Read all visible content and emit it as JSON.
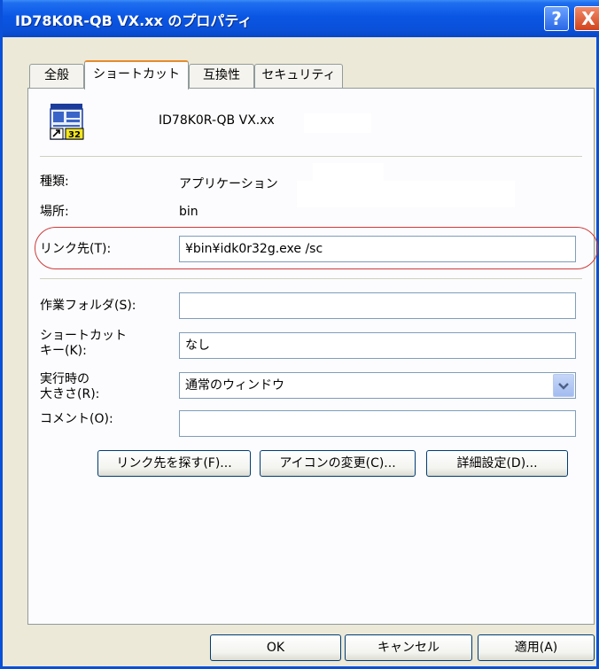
{
  "window": {
    "title": "ID78K0R-QB VX.xx のプロパティ"
  },
  "titlebar_buttons": {
    "help": "?",
    "close": "X"
  },
  "tabs": [
    {
      "label": "全般"
    },
    {
      "label": "ショートカット"
    },
    {
      "label": "互換性"
    },
    {
      "label": "セキュリティ"
    }
  ],
  "shortcut": {
    "name": "ID78K0R-QB VX.xx",
    "icon_badge": "32"
  },
  "fields": {
    "type_label": "種類:",
    "type_value": "アプリケーション",
    "location_label": "場所:",
    "location_value": "bin",
    "target_label": "リンク先(T):",
    "target_value": "¥bin¥idk0r32g.exe /sc",
    "workdir_label": "作業フォルダ(S):",
    "workdir_value": "",
    "hotkey_label_1": "ショートカット",
    "hotkey_label_2": "キー(K):",
    "hotkey_value": "なし",
    "run_label_1": "実行時の",
    "run_label_2": "大きさ(R):",
    "run_value": "通常のウィンドウ",
    "comment_label": "コメント(O):",
    "comment_value": ""
  },
  "buttons": {
    "find_target": "リンク先を探す(F)...",
    "change_icon": "アイコンの変更(C)...",
    "advanced": "詳細設定(D)...",
    "ok": "OK",
    "cancel": "キャンセル",
    "apply": "適用(A)"
  },
  "colors": {
    "title_blue": "#0a50d8",
    "highlight_red": "#cf3a3a",
    "dialog_bg": "#ece9d8"
  }
}
